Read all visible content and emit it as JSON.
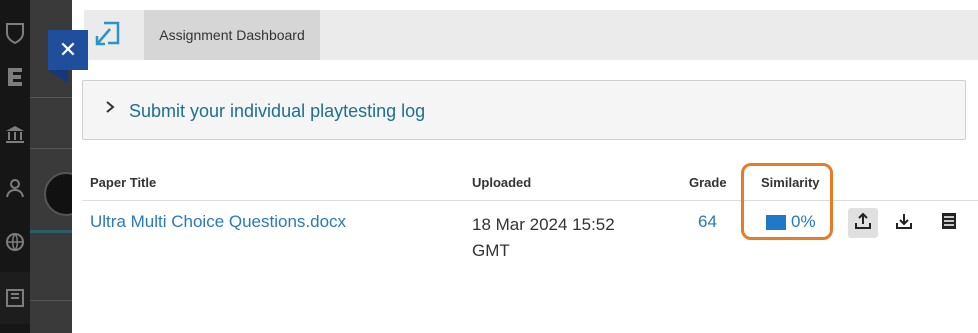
{
  "close_button": {
    "glyph": "✕",
    "accent": "#1f4e9d"
  },
  "tabs": [
    {
      "label": "Assignment Dashboard"
    }
  ],
  "assignment": {
    "title": "Submit your individual playtesting log"
  },
  "table": {
    "headers": {
      "paper_title": "Paper Title",
      "uploaded": "Uploaded",
      "grade": "Grade",
      "similarity": "Similarity"
    },
    "rows": [
      {
        "paper_title": "Ultra Multi Choice Questions.docx",
        "uploaded_line1": "18 Mar 2024 15:52",
        "uploaded_line2": "GMT",
        "grade": "64",
        "similarity": "0%",
        "similarity_color": "#1f78c8"
      }
    ]
  },
  "row_actions": [
    "upload-icon",
    "download-icon",
    "details-icon"
  ],
  "highlight_color": "#e97a27"
}
